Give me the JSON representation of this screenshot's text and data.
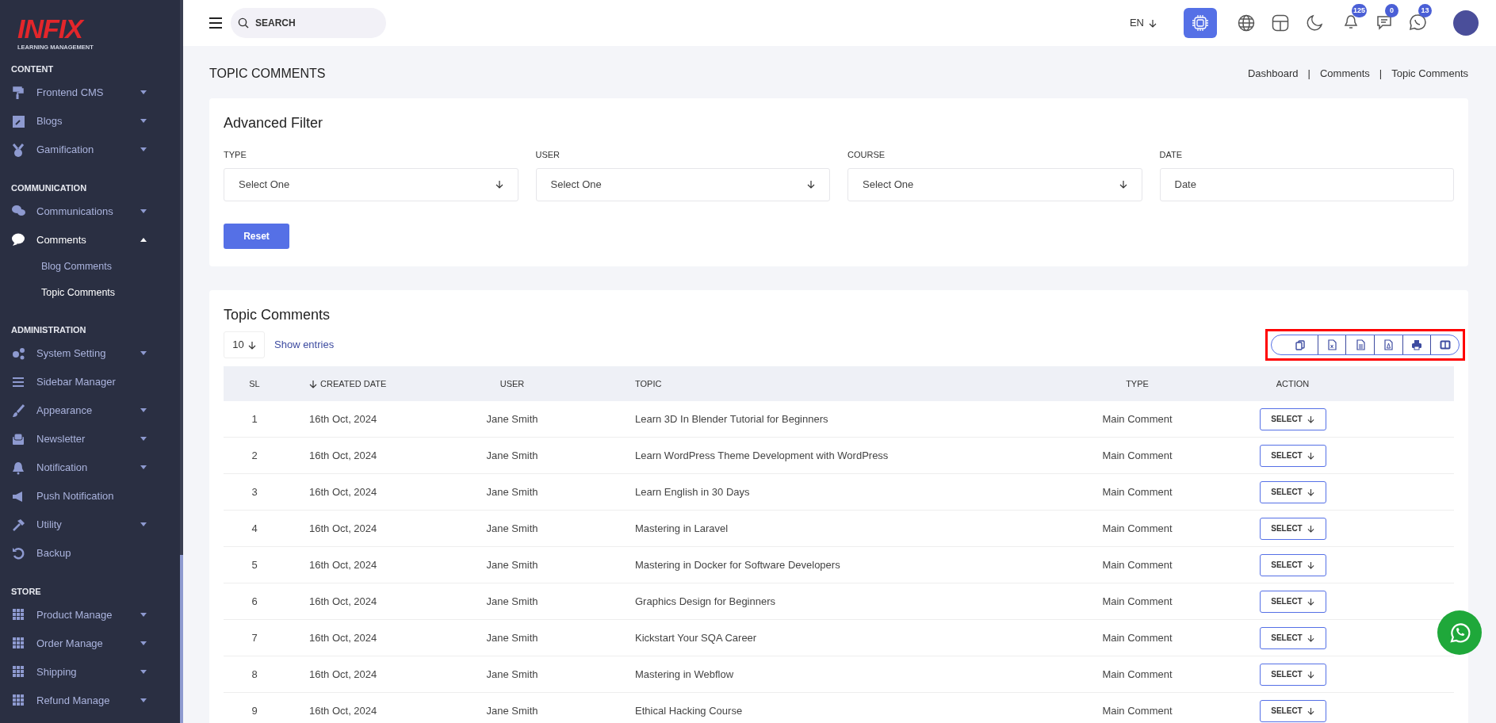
{
  "logo": {
    "brand": "INFIX",
    "tagline": "LEARNING MANAGEMENT"
  },
  "sidebar": {
    "sections": [
      {
        "title": "CONTENT",
        "items": [
          {
            "label": "Frontend CMS",
            "expandable": true,
            "expanded": false,
            "selected": false
          },
          {
            "label": "Blogs",
            "expandable": true,
            "expanded": false,
            "selected": false
          },
          {
            "label": "Gamification",
            "expandable": true,
            "expanded": false,
            "selected": false
          }
        ]
      },
      {
        "title": "COMMUNICATION",
        "items": [
          {
            "label": "Communications",
            "expandable": true,
            "expanded": false,
            "selected": false
          },
          {
            "label": "Comments",
            "expandable": true,
            "expanded": true,
            "selected": true,
            "children": [
              {
                "label": "Blog Comments",
                "selected": false
              },
              {
                "label": "Topic Comments",
                "selected": true
              }
            ]
          }
        ]
      },
      {
        "title": "ADMINISTRATION",
        "items": [
          {
            "label": "System Setting",
            "expandable": true,
            "expanded": false,
            "selected": false
          },
          {
            "label": "Sidebar Manager",
            "expandable": false,
            "selected": false
          },
          {
            "label": "Appearance",
            "expandable": true,
            "expanded": false,
            "selected": false
          },
          {
            "label": "Newsletter",
            "expandable": true,
            "expanded": false,
            "selected": false
          },
          {
            "label": "Notification",
            "expandable": true,
            "expanded": false,
            "selected": false
          },
          {
            "label": "Push Notification",
            "expandable": false,
            "selected": false
          },
          {
            "label": "Utility",
            "expandable": true,
            "expanded": false,
            "selected": false
          },
          {
            "label": "Backup",
            "expandable": false,
            "selected": false
          }
        ]
      },
      {
        "title": "STORE",
        "items": [
          {
            "label": "Product Manage",
            "expandable": true,
            "expanded": false,
            "selected": false
          },
          {
            "label": "Order Manage",
            "expandable": true,
            "expanded": false,
            "selected": false
          },
          {
            "label": "Shipping",
            "expandable": true,
            "expanded": false,
            "selected": false
          },
          {
            "label": "Refund Manage",
            "expandable": true,
            "expanded": false,
            "selected": false
          }
        ]
      }
    ]
  },
  "topbar": {
    "search": {
      "placeholder": "SEARCH"
    },
    "language": "EN",
    "badges": [
      "125",
      "0",
      "13"
    ]
  },
  "page": {
    "title": "TOPIC COMMENTS",
    "breadcrumbs": [
      "Dashboard",
      "Comments",
      "Topic Comments"
    ],
    "breadcrumb_separator": "|"
  },
  "filter": {
    "title": "Advanced Filter",
    "fields": [
      {
        "label": "TYPE",
        "placeholder": "Select One",
        "kind": "select"
      },
      {
        "label": "USER",
        "placeholder": "Select One",
        "kind": "select"
      },
      {
        "label": "COURSE",
        "placeholder": "Select One",
        "kind": "select"
      },
      {
        "label": "DATE",
        "placeholder": "Date",
        "kind": "date"
      }
    ],
    "reset": "Reset"
  },
  "table": {
    "title": "Topic Comments",
    "page_size": "10",
    "show_entries": "Show entries",
    "export_toolbar_highlighted": true,
    "columns": [
      {
        "label": "SL",
        "sorted": false
      },
      {
        "label": "CREATED DATE",
        "sorted": true
      },
      {
        "label": "USER",
        "sorted": false
      },
      {
        "label": "TOPIC",
        "sorted": false
      },
      {
        "label": "TYPE",
        "sorted": false
      },
      {
        "label": "ACTION",
        "sorted": false
      }
    ],
    "rows": [
      {
        "sl": "1",
        "date": "16th Oct, 2024",
        "user": "Jane Smith",
        "topic": "Learn 3D In Blender Tutorial for Beginners",
        "type": "Main Comment",
        "action": "SELECT"
      },
      {
        "sl": "2",
        "date": "16th Oct, 2024",
        "user": "Jane Smith",
        "topic": "Learn WordPress Theme Development with WordPress",
        "type": "Main Comment",
        "action": "SELECT"
      },
      {
        "sl": "3",
        "date": "16th Oct, 2024",
        "user": "Jane Smith",
        "topic": "Learn English in 30 Days",
        "type": "Main Comment",
        "action": "SELECT"
      },
      {
        "sl": "4",
        "date": "16th Oct, 2024",
        "user": "Jane Smith",
        "topic": "Mastering in Laravel",
        "type": "Main Comment",
        "action": "SELECT"
      },
      {
        "sl": "5",
        "date": "16th Oct, 2024",
        "user": "Jane Smith",
        "topic": "Mastering in Docker for Software Developers",
        "type": "Main Comment",
        "action": "SELECT"
      },
      {
        "sl": "6",
        "date": "16th Oct, 2024",
        "user": "Jane Smith",
        "topic": "Graphics Design for Beginners",
        "type": "Main Comment",
        "action": "SELECT"
      },
      {
        "sl": "7",
        "date": "16th Oct, 2024",
        "user": "Jane Smith",
        "topic": "Kickstart Your SQA Career",
        "type": "Main Comment",
        "action": "SELECT"
      },
      {
        "sl": "8",
        "date": "16th Oct, 2024",
        "user": "Jane Smith",
        "topic": "Mastering in Webflow",
        "type": "Main Comment",
        "action": "SELECT"
      },
      {
        "sl": "9",
        "date": "16th Oct, 2024",
        "user": "Jane Smith",
        "topic": "Ethical Hacking Course",
        "type": "Main Comment",
        "action": "SELECT"
      }
    ]
  }
}
